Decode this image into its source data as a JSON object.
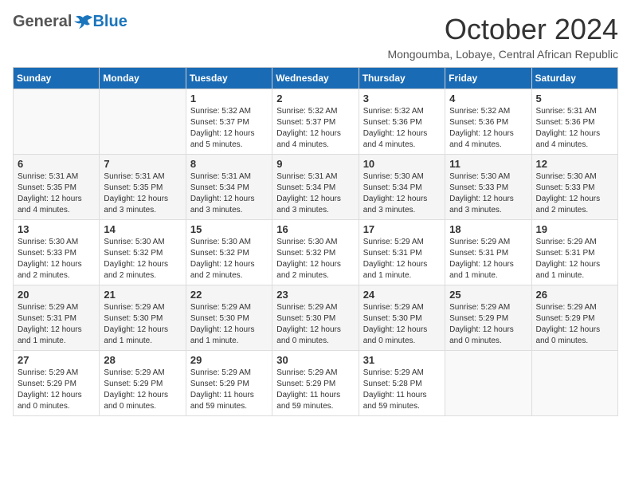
{
  "logo": {
    "general": "General",
    "blue": "Blue"
  },
  "title": "October 2024",
  "location": "Mongoumba, Lobaye, Central African Republic",
  "weekdays": [
    "Sunday",
    "Monday",
    "Tuesday",
    "Wednesday",
    "Thursday",
    "Friday",
    "Saturday"
  ],
  "weeks": [
    [
      {
        "day": "",
        "info": ""
      },
      {
        "day": "",
        "info": ""
      },
      {
        "day": "1",
        "info": "Sunrise: 5:32 AM\nSunset: 5:37 PM\nDaylight: 12 hours and 5 minutes."
      },
      {
        "day": "2",
        "info": "Sunrise: 5:32 AM\nSunset: 5:37 PM\nDaylight: 12 hours and 4 minutes."
      },
      {
        "day": "3",
        "info": "Sunrise: 5:32 AM\nSunset: 5:36 PM\nDaylight: 12 hours and 4 minutes."
      },
      {
        "day": "4",
        "info": "Sunrise: 5:32 AM\nSunset: 5:36 PM\nDaylight: 12 hours and 4 minutes."
      },
      {
        "day": "5",
        "info": "Sunrise: 5:31 AM\nSunset: 5:36 PM\nDaylight: 12 hours and 4 minutes."
      }
    ],
    [
      {
        "day": "6",
        "info": "Sunrise: 5:31 AM\nSunset: 5:35 PM\nDaylight: 12 hours and 4 minutes."
      },
      {
        "day": "7",
        "info": "Sunrise: 5:31 AM\nSunset: 5:35 PM\nDaylight: 12 hours and 3 minutes."
      },
      {
        "day": "8",
        "info": "Sunrise: 5:31 AM\nSunset: 5:34 PM\nDaylight: 12 hours and 3 minutes."
      },
      {
        "day": "9",
        "info": "Sunrise: 5:31 AM\nSunset: 5:34 PM\nDaylight: 12 hours and 3 minutes."
      },
      {
        "day": "10",
        "info": "Sunrise: 5:30 AM\nSunset: 5:34 PM\nDaylight: 12 hours and 3 minutes."
      },
      {
        "day": "11",
        "info": "Sunrise: 5:30 AM\nSunset: 5:33 PM\nDaylight: 12 hours and 3 minutes."
      },
      {
        "day": "12",
        "info": "Sunrise: 5:30 AM\nSunset: 5:33 PM\nDaylight: 12 hours and 2 minutes."
      }
    ],
    [
      {
        "day": "13",
        "info": "Sunrise: 5:30 AM\nSunset: 5:33 PM\nDaylight: 12 hours and 2 minutes."
      },
      {
        "day": "14",
        "info": "Sunrise: 5:30 AM\nSunset: 5:32 PM\nDaylight: 12 hours and 2 minutes."
      },
      {
        "day": "15",
        "info": "Sunrise: 5:30 AM\nSunset: 5:32 PM\nDaylight: 12 hours and 2 minutes."
      },
      {
        "day": "16",
        "info": "Sunrise: 5:30 AM\nSunset: 5:32 PM\nDaylight: 12 hours and 2 minutes."
      },
      {
        "day": "17",
        "info": "Sunrise: 5:29 AM\nSunset: 5:31 PM\nDaylight: 12 hours and 1 minute."
      },
      {
        "day": "18",
        "info": "Sunrise: 5:29 AM\nSunset: 5:31 PM\nDaylight: 12 hours and 1 minute."
      },
      {
        "day": "19",
        "info": "Sunrise: 5:29 AM\nSunset: 5:31 PM\nDaylight: 12 hours and 1 minute."
      }
    ],
    [
      {
        "day": "20",
        "info": "Sunrise: 5:29 AM\nSunset: 5:31 PM\nDaylight: 12 hours and 1 minute."
      },
      {
        "day": "21",
        "info": "Sunrise: 5:29 AM\nSunset: 5:30 PM\nDaylight: 12 hours and 1 minute."
      },
      {
        "day": "22",
        "info": "Sunrise: 5:29 AM\nSunset: 5:30 PM\nDaylight: 12 hours and 1 minute."
      },
      {
        "day": "23",
        "info": "Sunrise: 5:29 AM\nSunset: 5:30 PM\nDaylight: 12 hours and 0 minutes."
      },
      {
        "day": "24",
        "info": "Sunrise: 5:29 AM\nSunset: 5:30 PM\nDaylight: 12 hours and 0 minutes."
      },
      {
        "day": "25",
        "info": "Sunrise: 5:29 AM\nSunset: 5:29 PM\nDaylight: 12 hours and 0 minutes."
      },
      {
        "day": "26",
        "info": "Sunrise: 5:29 AM\nSunset: 5:29 PM\nDaylight: 12 hours and 0 minutes."
      }
    ],
    [
      {
        "day": "27",
        "info": "Sunrise: 5:29 AM\nSunset: 5:29 PM\nDaylight: 12 hours and 0 minutes."
      },
      {
        "day": "28",
        "info": "Sunrise: 5:29 AM\nSunset: 5:29 PM\nDaylight: 12 hours and 0 minutes."
      },
      {
        "day": "29",
        "info": "Sunrise: 5:29 AM\nSunset: 5:29 PM\nDaylight: 11 hours and 59 minutes."
      },
      {
        "day": "30",
        "info": "Sunrise: 5:29 AM\nSunset: 5:29 PM\nDaylight: 11 hours and 59 minutes."
      },
      {
        "day": "31",
        "info": "Sunrise: 5:29 AM\nSunset: 5:28 PM\nDaylight: 11 hours and 59 minutes."
      },
      {
        "day": "",
        "info": ""
      },
      {
        "day": "",
        "info": ""
      }
    ]
  ]
}
